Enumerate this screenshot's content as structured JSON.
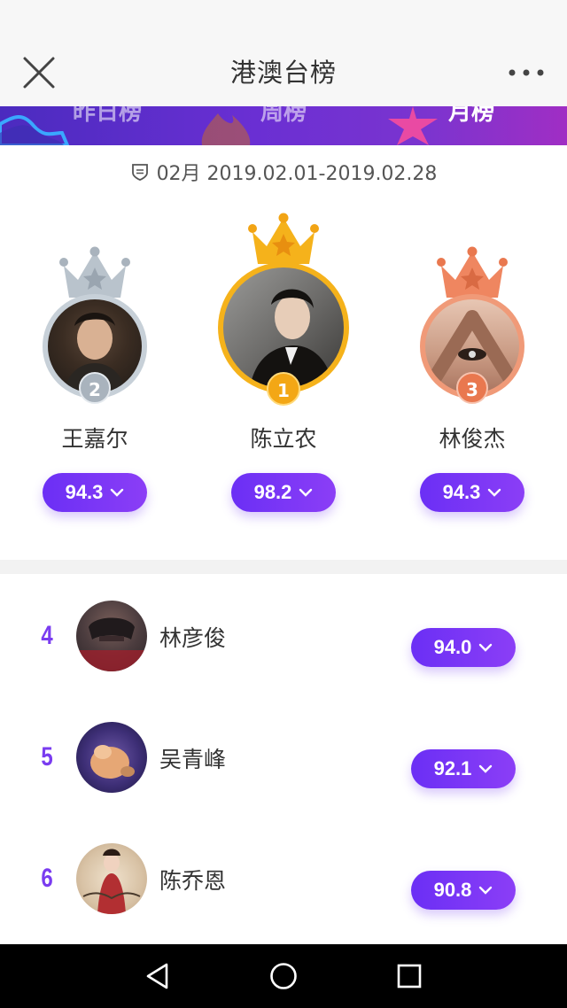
{
  "header": {
    "title": "港澳台榜",
    "close_icon": "close-icon",
    "more_icon": "more-horizontal-icon"
  },
  "tabs": [
    {
      "label": "昨日榜",
      "active": false
    },
    {
      "label": "周榜",
      "active": false
    },
    {
      "label": "月榜",
      "active": true
    }
  ],
  "period": {
    "icon": "badge-icon",
    "text": "02月 2019.02.01-2019.02.28"
  },
  "podium": [
    {
      "rank": "2",
      "name": "王嘉尔",
      "score": "94.3",
      "color": "#b9c3cc"
    },
    {
      "rank": "1",
      "name": "陈立农",
      "score": "98.2",
      "color": "#f5b21b"
    },
    {
      "rank": "3",
      "name": "林俊杰",
      "score": "94.3",
      "color": "#ef8660"
    }
  ],
  "list": [
    {
      "rank": "4",
      "name": "林彦俊",
      "score": "94.0"
    },
    {
      "rank": "5",
      "name": "吴青峰",
      "score": "92.1"
    },
    {
      "rank": "6",
      "name": "陈乔恩",
      "score": "90.8"
    }
  ],
  "colors": {
    "accent": "#7a3cf0",
    "pill_start": "#6b2ff5",
    "pill_end": "#8b3ef6",
    "gold": "#f5b21b",
    "silver": "#b9c3cc",
    "bronze": "#ef8660"
  },
  "navbar": {
    "back_icon": "back-triangle-icon",
    "home_icon": "home-circle-icon",
    "recents_icon": "recents-square-icon"
  }
}
